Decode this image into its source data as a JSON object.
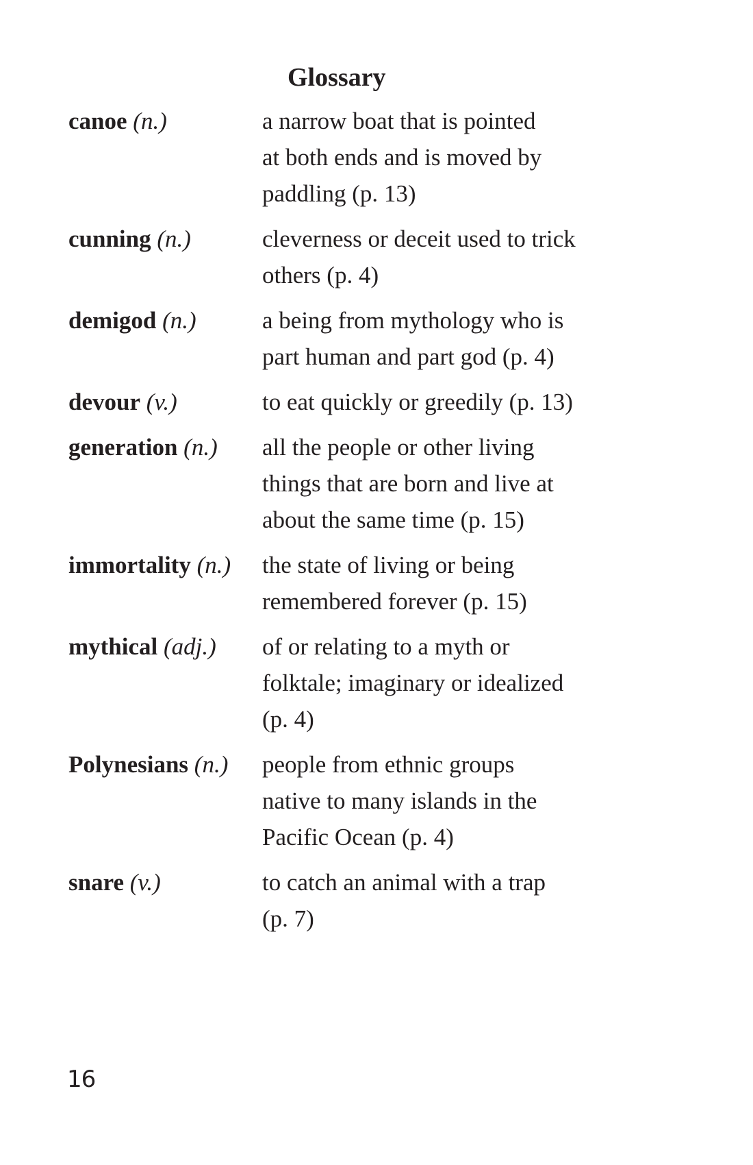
{
  "page": {
    "title": "Glossary",
    "page_number": "16"
  },
  "entries": [
    {
      "term": "canoe",
      "pos": "(n.)",
      "definition_lines": [
        "a narrow boat that is pointed",
        "at both ends and is moved by",
        "paddling (p. 13)"
      ]
    },
    {
      "term": "cunning",
      "pos": "(n.)",
      "definition_lines": [
        "cleverness or deceit used to trick",
        "others (p. 4)"
      ]
    },
    {
      "term": "demigod",
      "pos": "(n.)",
      "definition_lines": [
        "a being from mythology who is",
        "part human and part god (p. 4)"
      ]
    },
    {
      "term": "devour",
      "pos": "(v.)",
      "definition_lines": [
        "to eat quickly or greedily (p. 13)"
      ]
    },
    {
      "term": "generation",
      "pos": "(n.)",
      "definition_lines": [
        "all the people or other living",
        "things that are born and live at",
        "about the same time (p. 15)"
      ]
    },
    {
      "term": "immortality",
      "pos": "(n.)",
      "definition_lines": [
        "the state of living or being",
        "remembered forever (p. 15)"
      ]
    },
    {
      "term": "mythical",
      "pos": "(adj.)",
      "definition_lines": [
        "of or relating to a myth or",
        "folktale; imaginary or idealized",
        "(p. 4)"
      ]
    },
    {
      "term": "Polynesians",
      "pos": "(n.)",
      "definition_lines": [
        "people from ethnic groups",
        "native to many islands in the",
        "Pacific Ocean (p. 4)"
      ]
    },
    {
      "term": "snare",
      "pos": "(v.)",
      "definition_lines": [
        "to catch an animal with a trap",
        "(p. 7)"
      ]
    }
  ]
}
